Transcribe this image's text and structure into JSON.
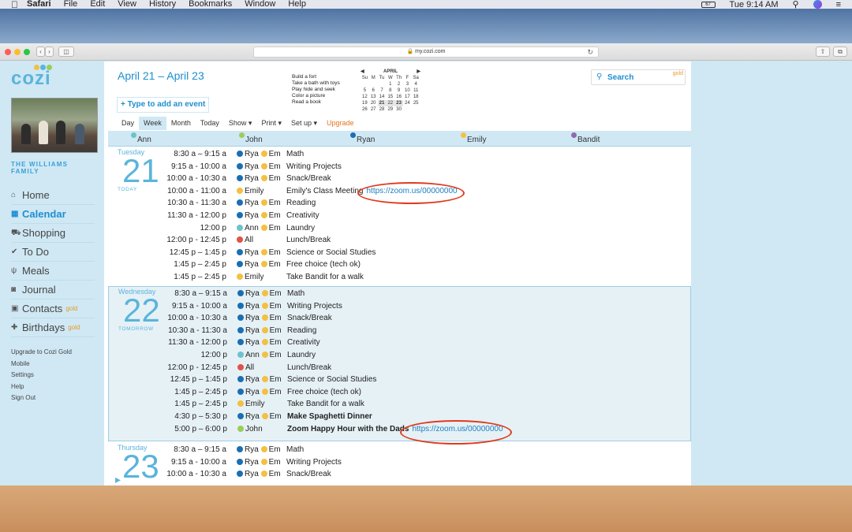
{
  "menubar": {
    "app": "Safari",
    "items": [
      "File",
      "Edit",
      "View",
      "History",
      "Bookmarks",
      "Window",
      "Help"
    ],
    "battery": "67",
    "clock": "Tue 9:14 AM"
  },
  "browser": {
    "url": "my.cozi.com"
  },
  "sidebar": {
    "logo": "cozi",
    "family": "THE WILLIAMS FAMILY",
    "nav": [
      {
        "icon": "home-icon",
        "glyph": "⌂",
        "label": "Home"
      },
      {
        "icon": "calendar-icon",
        "glyph": "▦",
        "label": "Calendar"
      },
      {
        "icon": "cart-icon",
        "glyph": "⛟",
        "label": "Shopping"
      },
      {
        "icon": "check-icon",
        "glyph": "✔",
        "label": "To Do"
      },
      {
        "icon": "utensils-icon",
        "glyph": "ψ",
        "label": "Meals"
      },
      {
        "icon": "camera-icon",
        "glyph": "◙",
        "label": "Journal"
      },
      {
        "icon": "contacts-icon",
        "glyph": "▣",
        "label": "Contacts",
        "badge": "gold"
      },
      {
        "icon": "gift-icon",
        "glyph": "✚",
        "label": "Birthdays",
        "badge": "gold"
      }
    ],
    "links": [
      "Upgrade to Cozi Gold",
      "Mobile",
      "Settings",
      "Help",
      "Sign Out"
    ]
  },
  "header": {
    "range": "April 21 – April 23",
    "add_event": "+ Type to add an event",
    "tabs": [
      "Day",
      "Week",
      "Month",
      "Today",
      "Show ▾",
      "Print ▾",
      "Set up ▾",
      "Upgrade"
    ],
    "todo": [
      "Build a fort",
      "Take a bath with toys",
      "Play hide and seek",
      "Color a picture",
      "Read a book"
    ],
    "search": "Search",
    "search_badge": "gold"
  },
  "minical": {
    "month": "APRIL",
    "weekdays": [
      "Su",
      "M",
      "Tu",
      "W",
      "Th",
      "F",
      "Sa"
    ],
    "weeks": [
      [
        "",
        "",
        "",
        "1",
        "2",
        "3",
        "4"
      ],
      [
        "5",
        "6",
        "7",
        "8",
        "9",
        "10",
        "11"
      ],
      [
        "12",
        "13",
        "14",
        "15",
        "16",
        "17",
        "18"
      ],
      [
        "19",
        "20",
        "21",
        "22",
        "23",
        "24",
        "25"
      ],
      [
        "26",
        "27",
        "28",
        "29",
        "30",
        "",
        ""
      ]
    ]
  },
  "people": [
    {
      "name": "Ann",
      "color": "#6cc3c9"
    },
    {
      "name": "John",
      "color": "#9ccc5a"
    },
    {
      "name": "Ryan",
      "color": "#1a6fb3"
    },
    {
      "name": "Emily",
      "color": "#f2c043"
    },
    {
      "name": "Bandit",
      "color": "#8c6bb0"
    }
  ],
  "days": [
    {
      "name": "Tuesday",
      "num": "21",
      "label": "TODAY",
      "events": [
        {
          "time": "8:30 a – 9:15 a",
          "who": [
            "Rya",
            "Em"
          ],
          "title": "Math"
        },
        {
          "time": "9:15 a - 10:00 a",
          "who": [
            "Rya",
            "Em"
          ],
          "title": "Writing Projects"
        },
        {
          "time": "10:00 a - 10:30 a",
          "who": [
            "Rya",
            "Em"
          ],
          "title": "Snack/Break"
        },
        {
          "time": "10:00 a - 11:00 a",
          "who": [
            "Emily"
          ],
          "title": "Emily's Class Meeting",
          "link": "https://zoom.us/00000000"
        },
        {
          "time": "10:30 a - 11:30 a",
          "who": [
            "Rya",
            "Em"
          ],
          "title": "Reading"
        },
        {
          "time": "11:30 a - 12:00 p",
          "who": [
            "Rya",
            "Em"
          ],
          "title": "Creativity"
        },
        {
          "time": "12:00 p",
          "who": [
            "Ann",
            "Em"
          ],
          "title": "Laundry"
        },
        {
          "time": "12:00 p - 12:45 p",
          "who": [
            "All"
          ],
          "title": "Lunch/Break"
        },
        {
          "time": "12:45 p – 1:45 p",
          "who": [
            "Rya",
            "Em"
          ],
          "title": "Science or Social Studies"
        },
        {
          "time": "1:45 p – 2:45 p",
          "who": [
            "Rya",
            "Em"
          ],
          "title": "Free choice (tech ok)"
        },
        {
          "time": "1:45 p – 2:45 p",
          "who": [
            "Emily"
          ],
          "title": "Take Bandit for a walk"
        }
      ]
    },
    {
      "name": "Wednesday",
      "num": "22",
      "label": "TOMORROW",
      "events": [
        {
          "time": "8:30 a – 9:15 a",
          "who": [
            "Rya",
            "Em"
          ],
          "title": "Math"
        },
        {
          "time": "9:15 a - 10:00 a",
          "who": [
            "Rya",
            "Em"
          ],
          "title": "Writing Projects"
        },
        {
          "time": "10:00 a - 10:30 a",
          "who": [
            "Rya",
            "Em"
          ],
          "title": "Snack/Break"
        },
        {
          "time": "10:30 a - 11:30 a",
          "who": [
            "Rya",
            "Em"
          ],
          "title": "Reading"
        },
        {
          "time": "11:30 a - 12:00 p",
          "who": [
            "Rya",
            "Em"
          ],
          "title": "Creativity"
        },
        {
          "time": "12:00 p",
          "who": [
            "Ann",
            "Em"
          ],
          "title": "Laundry"
        },
        {
          "time": "12:00 p - 12:45 p",
          "who": [
            "All"
          ],
          "title": "Lunch/Break"
        },
        {
          "time": "12:45 p – 1:45 p",
          "who": [
            "Rya",
            "Em"
          ],
          "title": "Science or Social Studies"
        },
        {
          "time": "1:45 p – 2:45 p",
          "who": [
            "Rya",
            "Em"
          ],
          "title": "Free choice (tech ok)"
        },
        {
          "time": "1:45 p – 2:45 p",
          "who": [
            "Emily"
          ],
          "title": "Take Bandit for a walk"
        },
        {
          "time": "4:30 p – 5:30 p",
          "who": [
            "Rya",
            "Em"
          ],
          "title": "Make Spaghetti Dinner",
          "bold": true
        },
        {
          "time": "5:00 p – 6:00 p",
          "who": [
            "John"
          ],
          "title": "Zoom Happy Hour with the Dads",
          "bold": true,
          "link": "https://zoom.us/00000000"
        }
      ]
    },
    {
      "name": "Thursday",
      "num": "23",
      "label": "",
      "events": [
        {
          "time": "8:30 a – 9:15 a",
          "who": [
            "Rya",
            "Em"
          ],
          "title": "Math"
        },
        {
          "time": "9:15 a - 10:00 a",
          "who": [
            "Rya",
            "Em"
          ],
          "title": "Writing Projects"
        },
        {
          "time": "10:00 a - 10:30 a",
          "who": [
            "Rya",
            "Em"
          ],
          "title": "Snack/Break"
        }
      ]
    }
  ],
  "colors": {
    "Rya": "#1a6fb3",
    "Em": "#f2c043",
    "Emily": "#f2c043",
    "Ann": "#6cc3c9",
    "All": "#e0524a",
    "John": "#9ccc5a",
    "accent": "#1e8fd0",
    "annotation": "#e03a1c"
  }
}
